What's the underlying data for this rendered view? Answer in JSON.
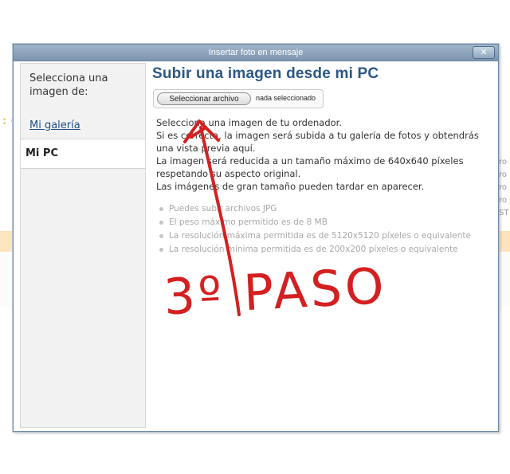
{
  "dialog": {
    "title": "Insertar foto en mensaje",
    "close_label": "✕"
  },
  "sidebar": {
    "prompt": "Selecciona una imagen de:",
    "items": [
      {
        "label": "Mi galería"
      },
      {
        "label": "Mi PC"
      }
    ]
  },
  "main": {
    "heading": "Subir una imagen desde mi PC",
    "file_button_label": "Seleccionar archivo",
    "file_status": "nada seleccionado",
    "description": [
      "Selecciona una imagen de tu ordenador.",
      "Si es correcta, la imagen será subida a tu galería de fotos y obtendrás una vista previa aquí.",
      "La imagen será reducida a un tamaño máximo de 640x640 píxeles respetando su aspecto original.",
      "Las imágenes de gran tamaño pueden tardar en aparecer."
    ],
    "rules": [
      "Puedes subir archivos JPG",
      "El peso máximo permitido es de 8 MB",
      "La resolución máxima permitida es de 5120x5120 píxeles o equivalente",
      "La resolución mínima permitida es de 200x200 píxeles o equivalente"
    ]
  },
  "background": {
    "dots": ": ·",
    "right_fragments": [
      "ro",
      "ro",
      "ro",
      "ro",
      "ST"
    ]
  },
  "annotation": {
    "text": "3º PASO",
    "color": "#d42020"
  },
  "colors": {
    "heading": "#2a5785",
    "titlebar": "#8fa6bd",
    "link": "#1f4e86"
  }
}
